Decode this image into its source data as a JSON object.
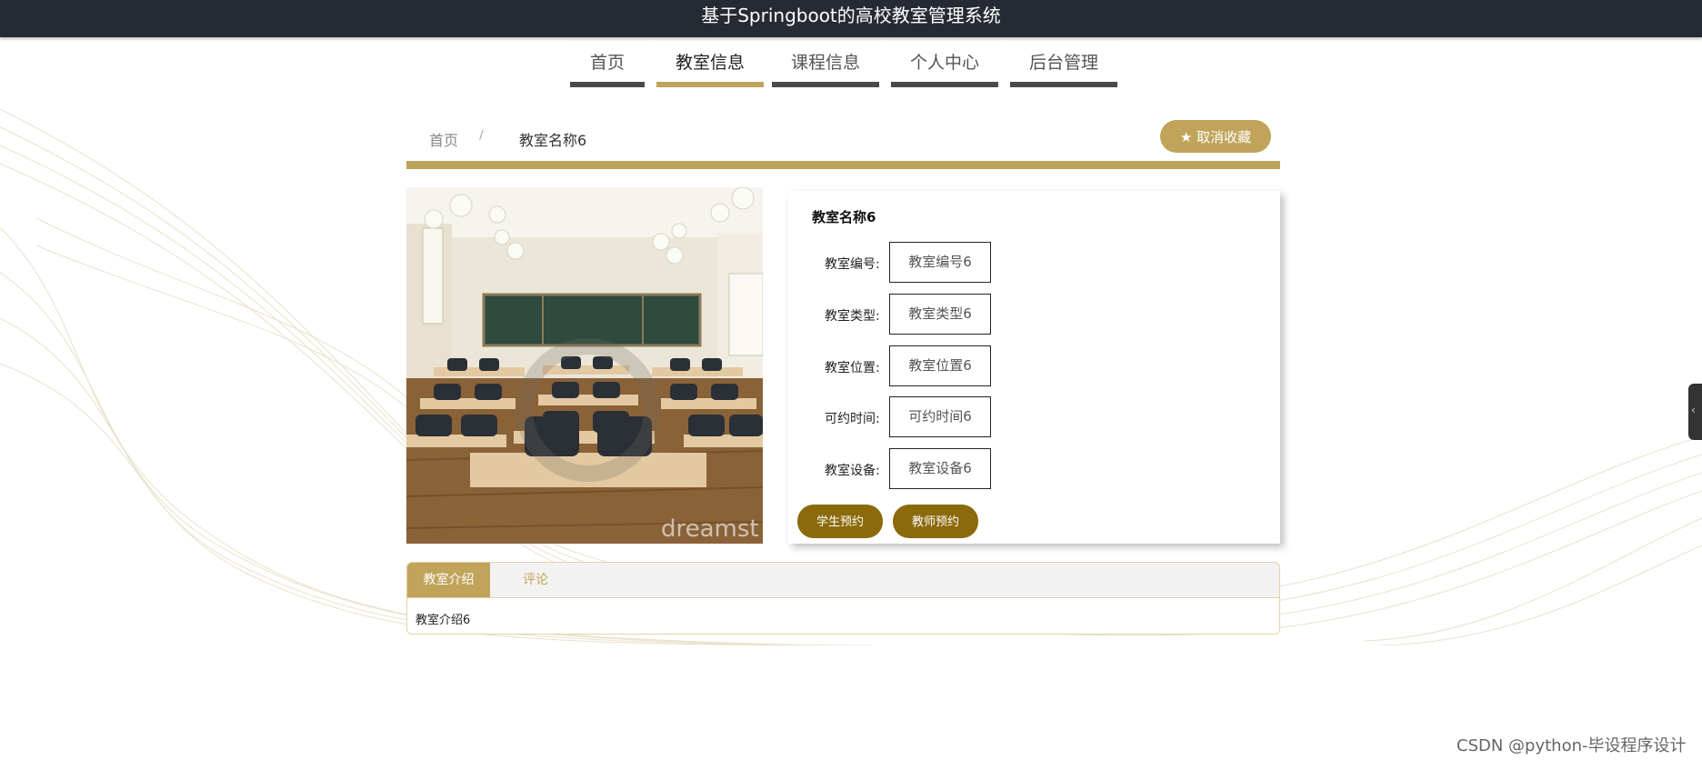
{
  "header": {
    "title": "基于Springboot的高校教室管理系统"
  },
  "nav": {
    "items": [
      {
        "label": "首页"
      },
      {
        "label": "教室信息"
      },
      {
        "label": "课程信息"
      },
      {
        "label": "个人中心"
      },
      {
        "label": "后台管理"
      }
    ],
    "active": "教室信息"
  },
  "breadcrumb": {
    "home": "首页",
    "separator": "/",
    "current": "教室名称6"
  },
  "favorite_button": {
    "label": "取消收藏",
    "icon": "star-icon"
  },
  "classroom": {
    "title": "教室名称6",
    "fields": [
      {
        "label": "教室编号:",
        "value": "教室编号6"
      },
      {
        "label": "教室类型:",
        "value": "教室类型6"
      },
      {
        "label": "教室位置:",
        "value": "教室位置6"
      },
      {
        "label": "可约时间:",
        "value": "可约时间6"
      },
      {
        "label": "教室设备:",
        "value": "教室设备6"
      }
    ],
    "photo_watermark": "dreamst"
  },
  "actions": {
    "student_booking": "学生预约",
    "teacher_booking": "教师预约"
  },
  "tabs": {
    "items": [
      {
        "label": "教室介绍"
      },
      {
        "label": "评论"
      }
    ],
    "content": "教室介绍6"
  },
  "watermark": "CSDN @python-毕设程序设计",
  "colors": {
    "accent": "#c0a45a",
    "button": "#8b6a0c",
    "header": "#262a33"
  }
}
